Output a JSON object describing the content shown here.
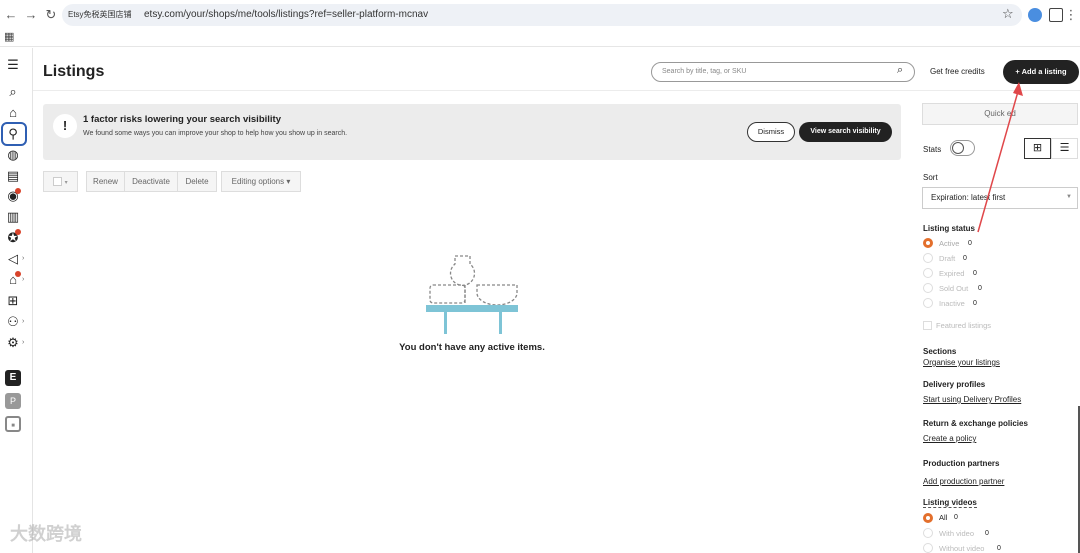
{
  "browser": {
    "site_chip": "Etsy免税英国店铺",
    "url": "etsy.com/your/shops/me/tools/listings?ref=seller-platform-mcnav"
  },
  "header": {
    "title": "Listings",
    "search_placeholder": "Search by title, tag, or SKU",
    "credits_label": "Get free credits",
    "add_label": "+ Add a listing"
  },
  "banner": {
    "title": "1 factor risks lowering your search visibility",
    "text": "We found some ways you can improve your shop to help how you show up in search.",
    "dismiss_label": "Dismiss",
    "view_label": "View search visibility"
  },
  "toolbar": {
    "renew": "Renew",
    "deactivate": "Deactivate",
    "delete": "Delete",
    "editing": "Editing options ▾"
  },
  "empty": {
    "message": "You don't have any active items."
  },
  "sidebar": {
    "quick_edit": "Quick ed",
    "stats_label": "Stats",
    "sort_label": "Sort",
    "sort_value": "Expiration: latest first",
    "status_label": "Listing status",
    "statuses": [
      {
        "label": "Active",
        "count": "0"
      },
      {
        "label": "Draft",
        "count": "0"
      },
      {
        "label": "Expired",
        "count": "0"
      },
      {
        "label": "Sold Out",
        "count": "0"
      },
      {
        "label": "Inactive",
        "count": "0"
      }
    ],
    "featured_label": "Featured listings",
    "sections_label": "Sections",
    "sections_link": "Organise your listings",
    "delivery_label": "Delivery profiles",
    "delivery_link": "Start using Delivery Profiles",
    "returns_label": "Return & exchange policies",
    "returns_link": "Create a policy",
    "production_label": "Production partners",
    "production_link": "Add production partner",
    "videos_label": "Listing videos",
    "videos": [
      {
        "label": "All",
        "count": "0"
      },
      {
        "label": "With video",
        "count": "0"
      },
      {
        "label": "Without video",
        "count": "0"
      }
    ]
  },
  "watermark": "大数跨境",
  "colors": {
    "accent": "#e36f2c",
    "primary_button": "#222222",
    "annotation_arrow": "#e0474a",
    "illustration_table": "#7ec4d6"
  }
}
